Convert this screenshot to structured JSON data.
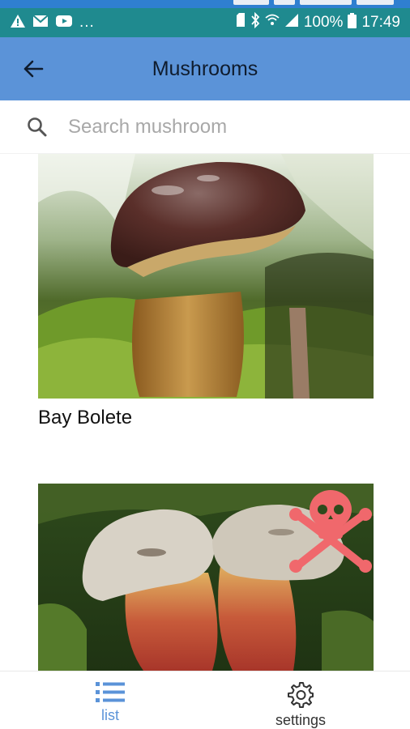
{
  "status_bar": {
    "notification_icons": [
      "warning-icon",
      "mail-icon",
      "youtube-icon"
    ],
    "more": "...",
    "battery_percent": "100%",
    "time": "17:49",
    "background": "#1f8a8f"
  },
  "app_bar": {
    "title": "Mushrooms",
    "back_icon": "arrow-left-icon",
    "background": "#5b93d8"
  },
  "search": {
    "placeholder": "Search mushroom",
    "value": ""
  },
  "mushrooms": [
    {
      "name": "Bay Bolete",
      "poisonous": false
    },
    {
      "name": "",
      "poisonous": true,
      "warning_icon": "skull-crossbones-icon",
      "warning_color": "#f0686c"
    }
  ],
  "bottom_nav": {
    "items": [
      {
        "label": "list",
        "icon": "list-icon",
        "active": true
      },
      {
        "label": "settings",
        "icon": "gear-icon",
        "active": false
      }
    ],
    "active_color": "#5b93d8"
  }
}
